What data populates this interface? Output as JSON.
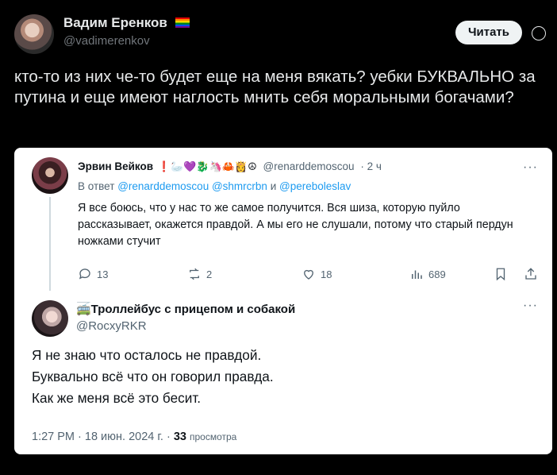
{
  "outer_post": {
    "display_name": "Вадим Еренков",
    "handle": "@vadimerenkov",
    "follow_label": "Читать",
    "text": "кто-то из них че-то будет еще на меня вякать? уебки БУКВАЛЬНО за путина и еще имеют наглость мнить себя моральными богачами?"
  },
  "quoted_tweet": {
    "display_name": "Эрвин Вейков",
    "emojis": "❗🦢💜🐉🦄🦀👸☮",
    "handle": "@renarddemoscou",
    "time": "· 2 ч",
    "reply_prefix": "В ответ",
    "reply_handles": "@renarddemoscou @shmrcrbn",
    "reply_and": "и",
    "reply_last": "@pereboleslav",
    "text": "Я все боюсь, что у нас то же самое получится. Вся шиза, которую пуйло рассказывает, окажется правдой. А мы его не слушали, потому что старый пердун ножками стучит",
    "replies": "13",
    "retweets": "2",
    "likes": "18",
    "views": "689"
  },
  "main_tweet": {
    "display_name": "🚎Троллейбус с прицепом и собакой",
    "handle": "@RocxyRKR",
    "lines": [
      "Я не знаю что осталось не правдой.",
      "Буквально всё что он говорил правда.",
      "Как же меня всё это бесит."
    ],
    "time": "1:27 PM",
    "date": "18 июн. 2024 г.",
    "views": "33",
    "views_label": "просмотра"
  }
}
